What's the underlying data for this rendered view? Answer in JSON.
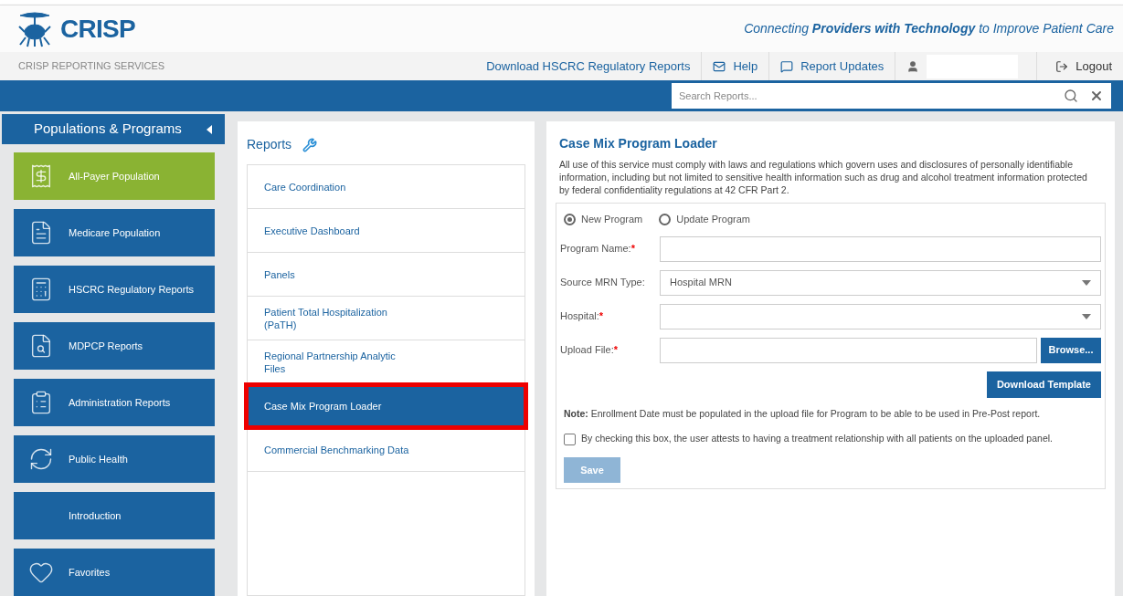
{
  "header": {
    "logo_text": "CRISP",
    "tagline": "Connecting **Providers with Technology** to Improve Patient Care"
  },
  "subnav": {
    "title": "CRISP REPORTING SERVICES",
    "links": [
      {
        "kind": "link",
        "label": "Download HSCRC Regulatory Reports"
      },
      {
        "kind": "help",
        "label": "Help"
      },
      {
        "kind": "updates",
        "label": "Report Updates"
      },
      {
        "kind": "user"
      },
      {
        "kind": "logout",
        "label": "Logout"
      }
    ]
  },
  "search": {
    "placeholder": "Search Reports..."
  },
  "sidebar": {
    "title": "Populations & Programs",
    "items": [
      {
        "label": "All-Payer Population",
        "selected": true
      },
      {
        "label": "Medicare Population",
        "selected": false
      },
      {
        "label": "HSCRC Regulatory Reports",
        "selected": false
      },
      {
        "label": "MDPCP Reports",
        "selected": false
      },
      {
        "label": "Administration Reports",
        "selected": false
      },
      {
        "label": "Public Health",
        "selected": false
      },
      {
        "label": "Introduction",
        "selected": false
      },
      {
        "label": "Favorites",
        "selected": false
      }
    ]
  },
  "reports": {
    "title": "Reports",
    "items": [
      {
        "label": "Care Coordination",
        "selected": false,
        "highlighted": false
      },
      {
        "label": "Executive Dashboard",
        "selected": false,
        "highlighted": false
      },
      {
        "label": "Panels",
        "selected": false,
        "highlighted": false
      },
      {
        "label": "Patient Total Hospitalization (PaTH)",
        "selected": false,
        "highlighted": false
      },
      {
        "label": "Regional Partnership Analytic Files",
        "selected": false,
        "highlighted": false
      },
      {
        "label": "Case Mix Program Loader",
        "selected": true,
        "highlighted": true
      },
      {
        "label": "Commercial Benchmarking Data",
        "selected": false,
        "highlighted": false
      }
    ]
  },
  "form": {
    "title": "Case Mix Program Loader",
    "notice": "All use of this service must comply with laws and regulations which govern uses and disclosures of personally identifiable information, including but not limited to sensitive health information such as drug and alcohol treatment information protected by federal confidentiality regulations at 42 CFR Part 2.",
    "radios": [
      {
        "label": "New Program",
        "selected": true
      },
      {
        "label": "Update Program",
        "selected": false
      }
    ],
    "fields": [
      {
        "kind": "text",
        "label": "Program Name:",
        "required_mark": "*"
      },
      {
        "kind": "select",
        "label": "Source MRN Type:",
        "value": "Hospital MRN"
      },
      {
        "kind": "select",
        "label": "Hospital:",
        "required_mark": "*"
      },
      {
        "kind": "file",
        "label": "Upload File:",
        "required_mark": "*",
        "button": "Browse..."
      }
    ],
    "download_button": "Download Template",
    "note": "**Note:** Enrollment Date must be populated in the upload file for Program to be able to be used in Pre-Post report.",
    "attest": {
      "label": "By checking this box, the user attests to having a treatment relationship with all patients on the uploaded panel.",
      "checked": false
    },
    "save": {
      "label": "Save",
      "disabled": true
    }
  }
}
